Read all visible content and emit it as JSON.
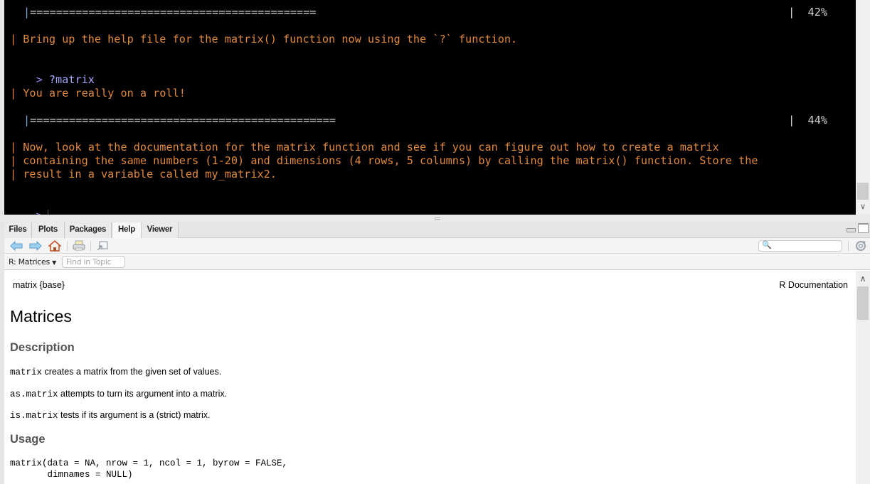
{
  "console": {
    "progress_1": {
      "bar": "|============================================",
      "percent_label": "|  42%",
      "value_percent": 42
    },
    "line_bring": "| Bring up the help file for the matrix() function now using the `?` function.",
    "prompt_1": {
      "char": ">",
      "command": "?matrix"
    },
    "line_roll": "| You are really on a roll!",
    "progress_2": {
      "bar": "|===============================================",
      "percent_label": "|  44%",
      "value_percent": 44
    },
    "instructions": [
      "| Now, look at the documentation for the matrix function and see if you can figure out how to create a matrix",
      "| containing the same numbers (1-20) and dimensions (4 rows, 5 columns) by calling the matrix() function. Store the",
      "| result in a variable called my_matrix2."
    ],
    "prompt_2": {
      "char": ">",
      "command": ""
    }
  },
  "pane": {
    "tabs": [
      {
        "label": "Files",
        "active": false
      },
      {
        "label": "Plots",
        "active": false
      },
      {
        "label": "Packages",
        "active": false
      },
      {
        "label": "Help",
        "active": true
      },
      {
        "label": "Viewer",
        "active": false
      }
    ],
    "toolbar": {
      "icons": [
        "back-arrow-icon",
        "forward-arrow-icon",
        "home-icon",
        "print-icon",
        "open-in-window-icon"
      ],
      "search_value": "",
      "refresh_icon": "refresh-icon"
    },
    "topic": {
      "select_label": "R: Matrices",
      "find_placeholder": "Find in Topic"
    },
    "doc": {
      "header_left": "matrix {base}",
      "header_right": "R Documentation",
      "title": "Matrices",
      "description_heading": "Description",
      "description": [
        {
          "code": "matrix",
          "text": " creates a matrix from the given set of values."
        },
        {
          "code": "as.matrix",
          "text": " attempts to turn its argument into a matrix."
        },
        {
          "code": "is.matrix",
          "text": " tests if its argument is a (strict) matrix."
        }
      ],
      "usage_heading": "Usage",
      "usage_code": "matrix(data = NA, nrow = 1, ncol = 1, byrow = FALSE,\n       dimnames = NULL)"
    }
  },
  "colors": {
    "console_bg": "#000000",
    "message_text": "#e0883c",
    "command_text": "#a8a8ff",
    "progress_text": "#d8d8d8",
    "section_heading": "#555555"
  }
}
